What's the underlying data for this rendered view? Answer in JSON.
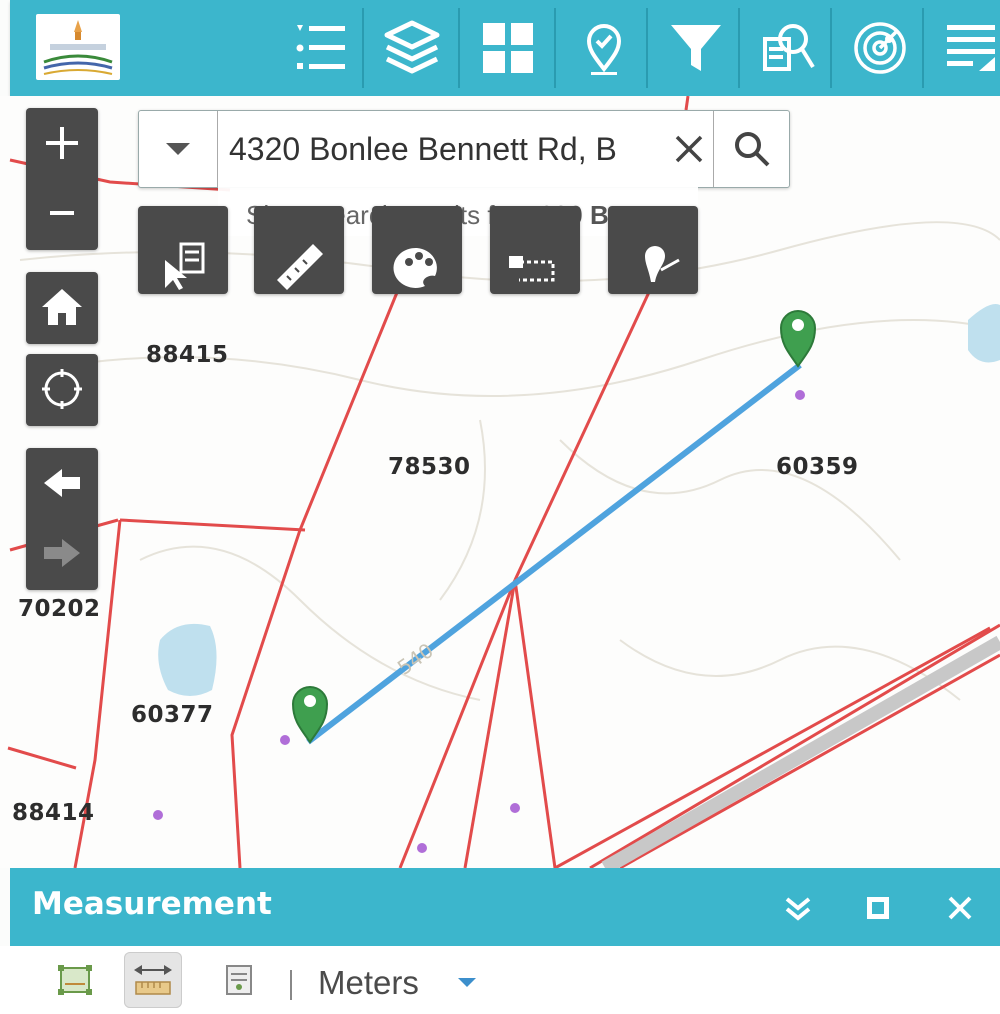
{
  "toolbar": {
    "buttons": [
      {
        "name": "legend-icon"
      },
      {
        "name": "layers-icon"
      },
      {
        "name": "basemap-gallery-icon"
      },
      {
        "name": "bookmark-pin-icon"
      },
      {
        "name": "filter-icon"
      },
      {
        "name": "query-icon"
      },
      {
        "name": "radar-icon"
      },
      {
        "name": "draw-edit-icon"
      }
    ],
    "accent_color": "#3cb6cc"
  },
  "search": {
    "value": "4320 Bonlee Bennett Rd, B",
    "suggestion_prefix": "Show search results for ",
    "suggestion_query": "4320 B..."
  },
  "map": {
    "parcels": [
      {
        "id": "88415"
      },
      {
        "id": "78530"
      },
      {
        "id": "60359"
      },
      {
        "id": "70202"
      },
      {
        "id": "60377"
      },
      {
        "id": "88414"
      }
    ],
    "measure_label": "540",
    "parcel_line_color": "#e24b4b",
    "measure_line_color": "#4fa3de",
    "marker_color": "#3f9f4f",
    "point_color": "#b06ed8"
  },
  "measurement": {
    "title": "Measurement",
    "units": "Meters",
    "tools": [
      "area-tool-icon",
      "distance-tool-icon",
      "location-tool-icon"
    ]
  }
}
